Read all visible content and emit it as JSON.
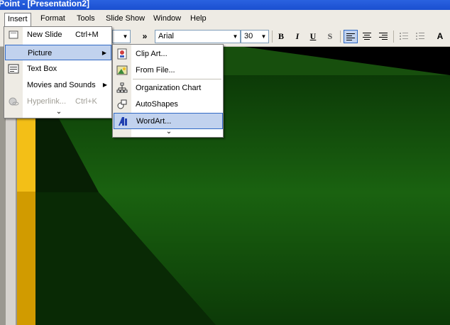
{
  "window": {
    "title": "Point - [Presentation2]"
  },
  "menubar": {
    "items": [
      {
        "label": "Insert",
        "active": true
      },
      {
        "label": "Format"
      },
      {
        "label": "Tools"
      },
      {
        "label": "Slide Show"
      },
      {
        "label": "Window"
      },
      {
        "label": "Help"
      }
    ]
  },
  "toolbar": {
    "more_glyph": "»",
    "font_name": "Arial",
    "font_size": "30",
    "bold": "B",
    "italic": "I",
    "underline": "U",
    "shadow": "S"
  },
  "insert_menu": {
    "items": [
      {
        "label": "New Slide",
        "shortcut": "Ctrl+M",
        "icon": "new-slide-icon"
      },
      {
        "label": "Picture",
        "submenu": true,
        "selected": true
      },
      {
        "label": "Text Box",
        "icon": "text-box-icon"
      },
      {
        "label": "Movies and Sounds",
        "submenu": true
      },
      {
        "label": "Hyperlink...",
        "shortcut": "Ctrl+K",
        "disabled": true,
        "icon": "hyperlink-icon"
      }
    ],
    "expand_glyph": "⌄"
  },
  "picture_submenu": {
    "items": [
      {
        "label": "Clip Art...",
        "icon": "clip-art-icon"
      },
      {
        "label": "From File...",
        "icon": "from-file-icon"
      },
      {
        "label": "Organization Chart",
        "icon": "org-chart-icon"
      },
      {
        "label": "AutoShapes",
        "icon": "autoshapes-icon"
      },
      {
        "label": "WordArt...",
        "icon": "wordart-icon",
        "selected": true
      }
    ],
    "expand_glyph": "⌄"
  },
  "colors": {
    "menu_highlight": "#c1d2ee",
    "menu_highlight_border": "#316ac5",
    "slide_green": "#1a5c10",
    "slide_gold": "#f3bf17"
  }
}
